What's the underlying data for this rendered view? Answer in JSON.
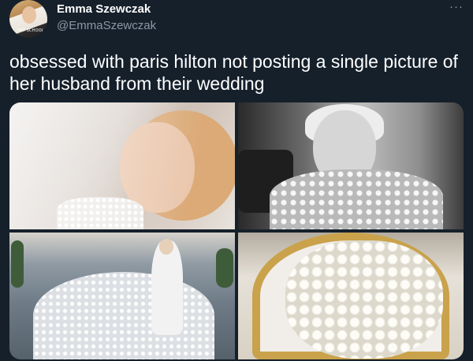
{
  "tweet": {
    "author_name": "Emma Szewczak",
    "author_handle": "@EmmaSzewczak",
    "avatar_caption": "PET SCHOOL",
    "more_label": "···",
    "text": "obsessed with paris hilton not posting a single picture of her husband from their wedding"
  },
  "media": {
    "photos": [
      {
        "name": "photo-bride-veil"
      },
      {
        "name": "photo-bride-closeup-bw"
      },
      {
        "name": "photo-wedding-gown-train"
      },
      {
        "name": "photo-white-rose-heart"
      }
    ]
  },
  "colors": {
    "background": "#15202b",
    "primary_text": "#ffffff",
    "secondary_text": "#8b98a5"
  }
}
